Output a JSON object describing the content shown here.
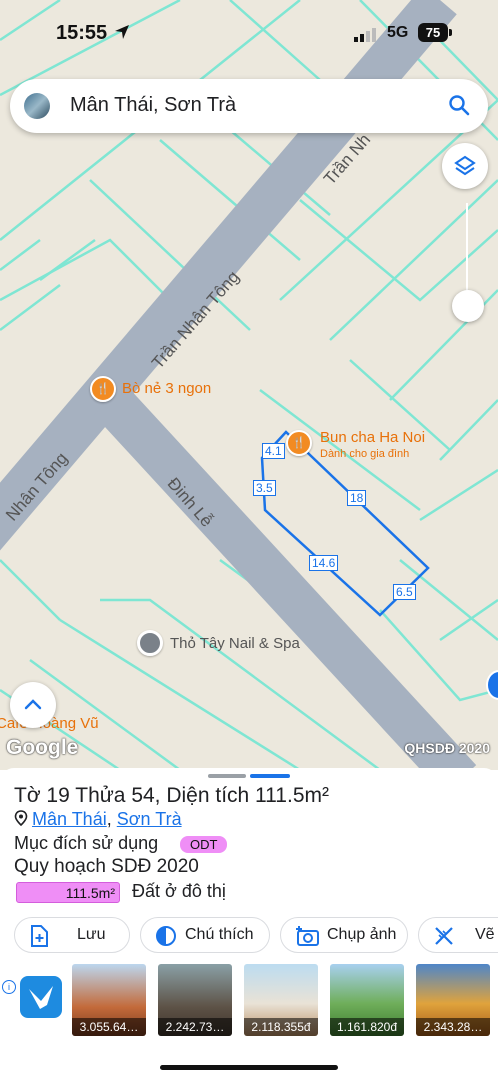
{
  "status_bar": {
    "time": "15:55",
    "network": "5G",
    "battery": "75"
  },
  "search": {
    "query": "Mân Thái, Sơn Trà"
  },
  "map": {
    "roads": [
      "Trần Nh",
      "Trần Nhân Tông",
      "Nhân Tông",
      "Đinh Lễ"
    ],
    "pois": [
      {
        "name": "Bò nẻ 3 ngon"
      },
      {
        "name": "Bun cha Ha Noi",
        "sub": "Dành cho gia đình"
      },
      {
        "name": "Thỏ Tây Nail & Spa"
      },
      {
        "name": "Cafe Hoàng Vũ"
      }
    ],
    "dimensions": [
      "4.1",
      "3.5",
      "18",
      "14.6",
      "6.5"
    ],
    "google_logo": "Google",
    "attribution": "QHSDĐ 2020",
    "parcel_color": "#1a73e8"
  },
  "sheet": {
    "title": "Tờ 19 Thửa 54, Diện tích 111.5m²",
    "ward": "Mân Thái",
    "separator": ",",
    "district": "Sơn Trà",
    "purpose_label": "Mục đích sử dụng",
    "purpose_code": "ODT",
    "plan_label": "Quy hoạch SDĐ 2020",
    "area_value": "111.5m²",
    "land_use": "Đất ở đô thị",
    "badge_color": "#ef8ef6"
  },
  "actions": [
    {
      "label": "Lưu",
      "icon": "add-file-icon"
    },
    {
      "label": "Chú thích",
      "icon": "legend-icon"
    },
    {
      "label": "Chụp ảnh",
      "icon": "camera-icon"
    },
    {
      "label": "Vẽ",
      "icon": "ruler-icon"
    }
  ],
  "ad": {
    "prices": [
      "3.055.64…",
      "2.242.73…",
      "2.118.355đ",
      "1.161.820đ",
      "2.343.28…"
    ]
  }
}
